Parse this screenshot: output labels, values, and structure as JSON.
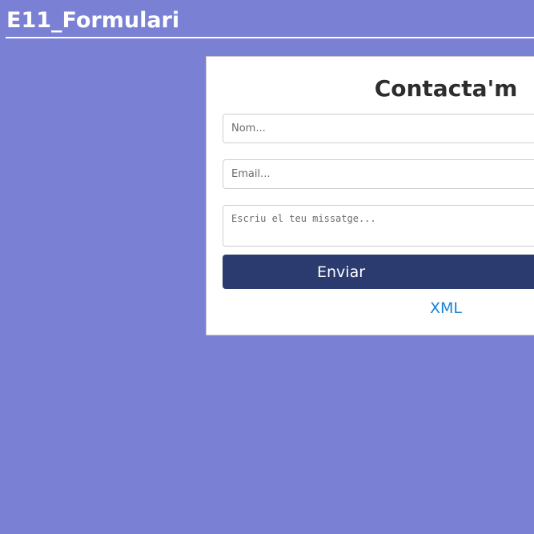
{
  "header": {
    "title": "E11_Formulari"
  },
  "form": {
    "title": "Contacta'm",
    "name_placeholder": "Nom...",
    "email_placeholder": "Email...",
    "message_placeholder": "Escriu el teu missatge...",
    "submit_label": "Enviar",
    "xml_link": "XML"
  },
  "colors": {
    "background": "#7a80d4",
    "button": "#2b3b6f",
    "link": "#1a82d6"
  }
}
